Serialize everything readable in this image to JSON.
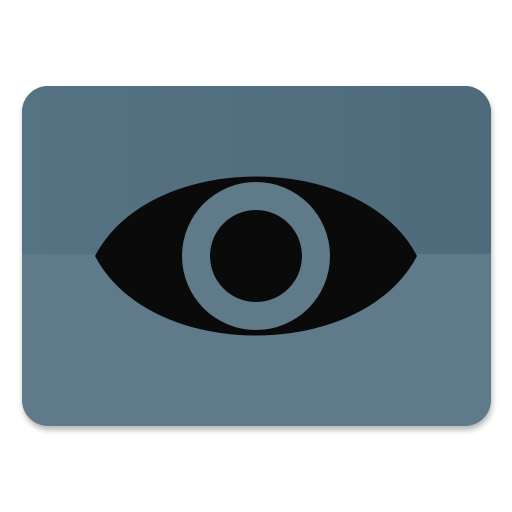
{
  "icon": {
    "name": "eye-icon",
    "colors": {
      "card_lower": "#5f7b8a",
      "card_upper": "#557282",
      "card_upper_dark": "#4e6a7a",
      "shadow": "#000000",
      "eye": "#0a0a0a",
      "iris_ring": "#5f7b8a"
    }
  }
}
